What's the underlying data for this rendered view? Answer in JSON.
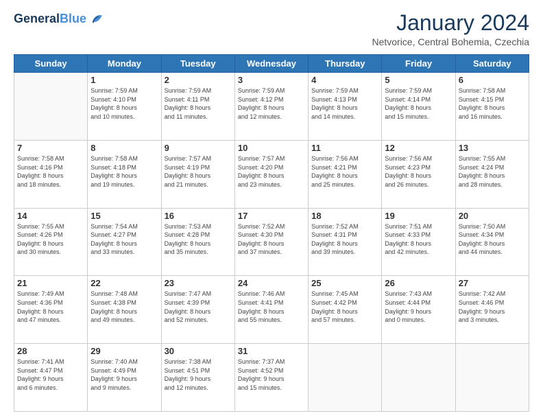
{
  "header": {
    "logo_line1": "General",
    "logo_line2": "Blue",
    "month": "January 2024",
    "location": "Netvorice, Central Bohemia, Czechia"
  },
  "weekdays": [
    "Sunday",
    "Monday",
    "Tuesday",
    "Wednesday",
    "Thursday",
    "Friday",
    "Saturday"
  ],
  "weeks": [
    [
      {
        "day": "",
        "info": ""
      },
      {
        "day": "1",
        "info": "Sunrise: 7:59 AM\nSunset: 4:10 PM\nDaylight: 8 hours\nand 10 minutes."
      },
      {
        "day": "2",
        "info": "Sunrise: 7:59 AM\nSunset: 4:11 PM\nDaylight: 8 hours\nand 11 minutes."
      },
      {
        "day": "3",
        "info": "Sunrise: 7:59 AM\nSunset: 4:12 PM\nDaylight: 8 hours\nand 12 minutes."
      },
      {
        "day": "4",
        "info": "Sunrise: 7:59 AM\nSunset: 4:13 PM\nDaylight: 8 hours\nand 14 minutes."
      },
      {
        "day": "5",
        "info": "Sunrise: 7:59 AM\nSunset: 4:14 PM\nDaylight: 8 hours\nand 15 minutes."
      },
      {
        "day": "6",
        "info": "Sunrise: 7:58 AM\nSunset: 4:15 PM\nDaylight: 8 hours\nand 16 minutes."
      }
    ],
    [
      {
        "day": "7",
        "info": "Sunrise: 7:58 AM\nSunset: 4:16 PM\nDaylight: 8 hours\nand 18 minutes."
      },
      {
        "day": "8",
        "info": "Sunrise: 7:58 AM\nSunset: 4:18 PM\nDaylight: 8 hours\nand 19 minutes."
      },
      {
        "day": "9",
        "info": "Sunrise: 7:57 AM\nSunset: 4:19 PM\nDaylight: 8 hours\nand 21 minutes."
      },
      {
        "day": "10",
        "info": "Sunrise: 7:57 AM\nSunset: 4:20 PM\nDaylight: 8 hours\nand 23 minutes."
      },
      {
        "day": "11",
        "info": "Sunrise: 7:56 AM\nSunset: 4:21 PM\nDaylight: 8 hours\nand 25 minutes."
      },
      {
        "day": "12",
        "info": "Sunrise: 7:56 AM\nSunset: 4:23 PM\nDaylight: 8 hours\nand 26 minutes."
      },
      {
        "day": "13",
        "info": "Sunrise: 7:55 AM\nSunset: 4:24 PM\nDaylight: 8 hours\nand 28 minutes."
      }
    ],
    [
      {
        "day": "14",
        "info": "Sunrise: 7:55 AM\nSunset: 4:26 PM\nDaylight: 8 hours\nand 30 minutes."
      },
      {
        "day": "15",
        "info": "Sunrise: 7:54 AM\nSunset: 4:27 PM\nDaylight: 8 hours\nand 33 minutes."
      },
      {
        "day": "16",
        "info": "Sunrise: 7:53 AM\nSunset: 4:28 PM\nDaylight: 8 hours\nand 35 minutes."
      },
      {
        "day": "17",
        "info": "Sunrise: 7:52 AM\nSunset: 4:30 PM\nDaylight: 8 hours\nand 37 minutes."
      },
      {
        "day": "18",
        "info": "Sunrise: 7:52 AM\nSunset: 4:31 PM\nDaylight: 8 hours\nand 39 minutes."
      },
      {
        "day": "19",
        "info": "Sunrise: 7:51 AM\nSunset: 4:33 PM\nDaylight: 8 hours\nand 42 minutes."
      },
      {
        "day": "20",
        "info": "Sunrise: 7:50 AM\nSunset: 4:34 PM\nDaylight: 8 hours\nand 44 minutes."
      }
    ],
    [
      {
        "day": "21",
        "info": "Sunrise: 7:49 AM\nSunset: 4:36 PM\nDaylight: 8 hours\nand 47 minutes."
      },
      {
        "day": "22",
        "info": "Sunrise: 7:48 AM\nSunset: 4:38 PM\nDaylight: 8 hours\nand 49 minutes."
      },
      {
        "day": "23",
        "info": "Sunrise: 7:47 AM\nSunset: 4:39 PM\nDaylight: 8 hours\nand 52 minutes."
      },
      {
        "day": "24",
        "info": "Sunrise: 7:46 AM\nSunset: 4:41 PM\nDaylight: 8 hours\nand 55 minutes."
      },
      {
        "day": "25",
        "info": "Sunrise: 7:45 AM\nSunset: 4:42 PM\nDaylight: 8 hours\nand 57 minutes."
      },
      {
        "day": "26",
        "info": "Sunrise: 7:43 AM\nSunset: 4:44 PM\nDaylight: 9 hours\nand 0 minutes."
      },
      {
        "day": "27",
        "info": "Sunrise: 7:42 AM\nSunset: 4:46 PM\nDaylight: 9 hours\nand 3 minutes."
      }
    ],
    [
      {
        "day": "28",
        "info": "Sunrise: 7:41 AM\nSunset: 4:47 PM\nDaylight: 9 hours\nand 6 minutes."
      },
      {
        "day": "29",
        "info": "Sunrise: 7:40 AM\nSunset: 4:49 PM\nDaylight: 9 hours\nand 9 minutes."
      },
      {
        "day": "30",
        "info": "Sunrise: 7:38 AM\nSunset: 4:51 PM\nDaylight: 9 hours\nand 12 minutes."
      },
      {
        "day": "31",
        "info": "Sunrise: 7:37 AM\nSunset: 4:52 PM\nDaylight: 9 hours\nand 15 minutes."
      },
      {
        "day": "",
        "info": ""
      },
      {
        "day": "",
        "info": ""
      },
      {
        "day": "",
        "info": ""
      }
    ]
  ]
}
